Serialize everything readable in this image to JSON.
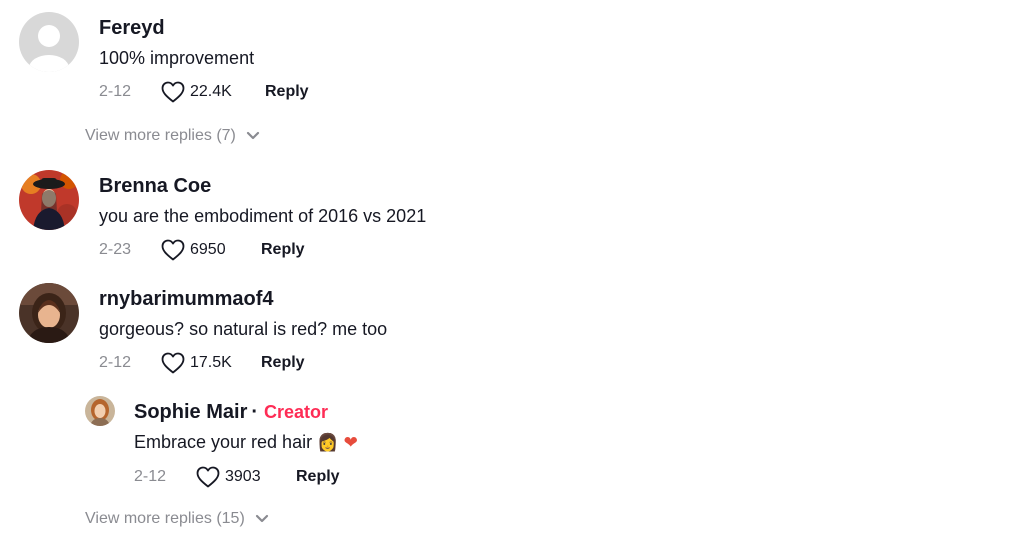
{
  "comments": [
    {
      "username": "Fereyd",
      "text": "100% improvement",
      "date": "2-12",
      "likes": "22.4K",
      "reply_label": "Reply",
      "view_more": "View more replies (7)"
    },
    {
      "username": "Brenna Coe",
      "text": "you are the embodiment of 2016 vs 2021",
      "date": "2-23",
      "likes": "6950",
      "reply_label": "Reply"
    },
    {
      "username": "rnybarimummaof4",
      "text": "gorgeous? so natural is red? me too",
      "date": "2-12",
      "likes": "17.5K",
      "reply_label": "Reply",
      "replies": [
        {
          "username": "Sophie Mair",
          "badge_separator": "·",
          "badge": "Creator",
          "text": "Embrace your red hair",
          "emojis": "👩 ❤",
          "date": "2-12",
          "likes": "3903",
          "reply_label": "Reply"
        }
      ],
      "view_more": "View more replies (15)"
    }
  ],
  "colors": {
    "text_primary": "#161823",
    "text_secondary": "#8a8b91",
    "creator_accent": "#fe2c55",
    "avatar_placeholder": "#d8d8d8"
  }
}
